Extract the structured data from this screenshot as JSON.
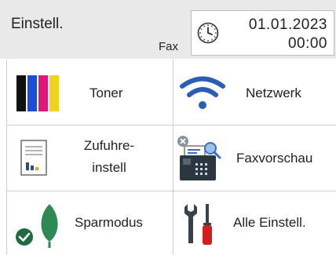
{
  "header": {
    "title": "Einstell.",
    "mode": "Fax",
    "date": "01.01.2023",
    "time": "00:00"
  },
  "tiles": [
    {
      "label": "Toner",
      "icon": "toner-icon"
    },
    {
      "label": "Netzwerk",
      "icon": "wifi-icon"
    },
    {
      "label_line1": "Zufuhre-",
      "label_line2": "instell",
      "icon": "document-report-icon"
    },
    {
      "label": "Faxvorschau",
      "icon": "fax-preview-icon"
    },
    {
      "label": "Sparmodus",
      "icon": "eco-leaf-icon"
    },
    {
      "label": "Alle Einstell.",
      "icon": "tools-icon"
    }
  ],
  "colors": {
    "header_bg": "#e9e9e9",
    "toner": [
      "#111111",
      "#1a4fd6",
      "#e0167a",
      "#f2d21b"
    ],
    "wifi": "#2a5eb5",
    "leaf": "#2e8a55",
    "check_badge": "#1f6b3e",
    "wrench": "#cfd4d8",
    "screwdriver_handle": "#d01f1f"
  }
}
